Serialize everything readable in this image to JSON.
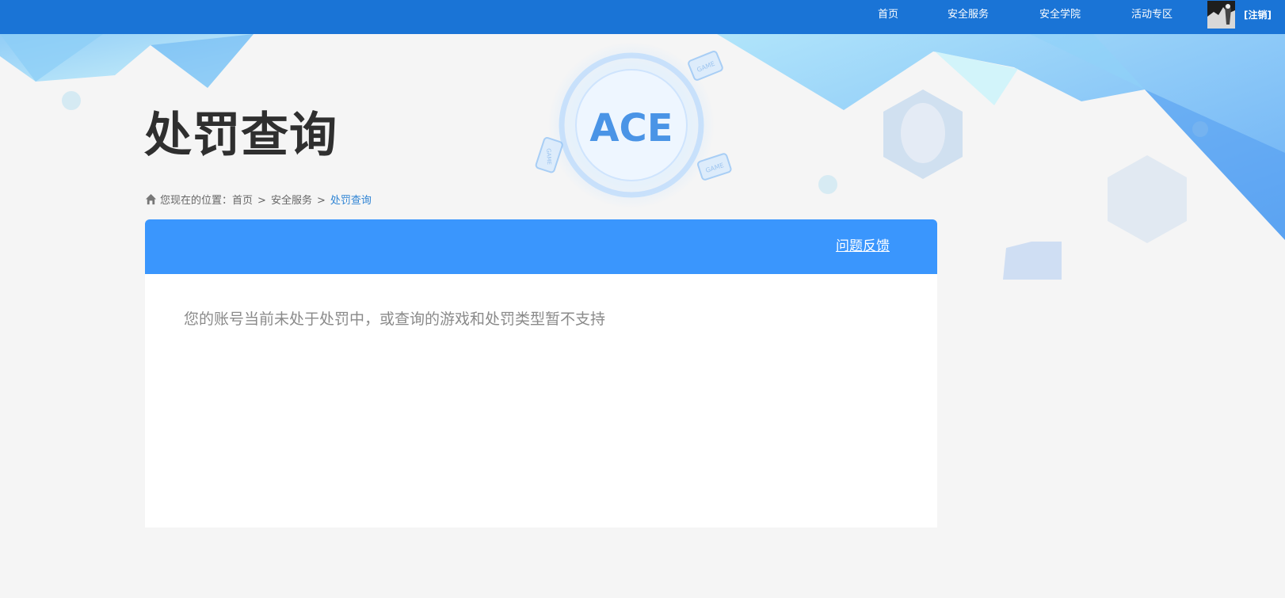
{
  "nav": {
    "items": [
      {
        "label": "首页"
      },
      {
        "label": "安全服务"
      },
      {
        "label": "安全学院"
      },
      {
        "label": "活动专区"
      }
    ],
    "logout_label": "[注销]"
  },
  "banner": {
    "logo_text": "ACE",
    "device_labels": [
      "GAME",
      "GAME",
      "GAME"
    ]
  },
  "page": {
    "title": "处罚查询"
  },
  "breadcrumb": {
    "prefix": "您现在的位置：",
    "separator": ">",
    "items": [
      {
        "label": "首页"
      },
      {
        "label": "安全服务"
      },
      {
        "label": "处罚查询"
      }
    ]
  },
  "panel": {
    "feedback_label": "问题反馈",
    "message": "您的账号当前未处于处罚中，或查询的游戏和处罚类型暂不支持"
  },
  "colors": {
    "topbar": "#1a74d6",
    "panel_header": "#3a96fd",
    "breadcrumb_current": "#2f84d4",
    "page_background": "#f5f5f5"
  }
}
